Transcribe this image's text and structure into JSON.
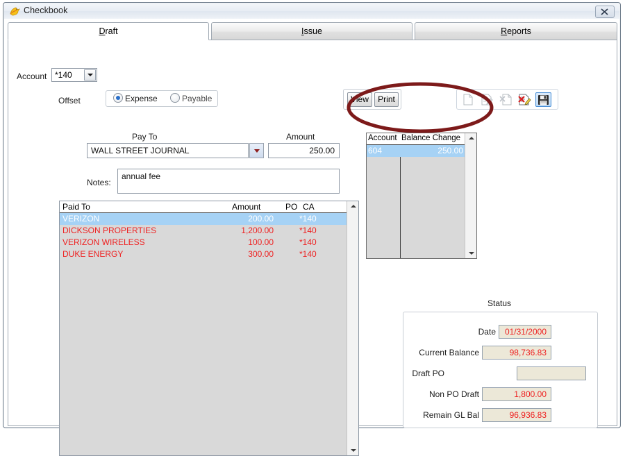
{
  "window": {
    "title": "Checkbook",
    "icon": "app-bird-icon",
    "close_label": "Close"
  },
  "tabs": [
    {
      "id": "draft",
      "label": "Draft",
      "mnemonic": "D",
      "active": true
    },
    {
      "id": "issue",
      "label": "Issue",
      "mnemonic": "I",
      "active": false
    },
    {
      "id": "reports",
      "label": "Reports",
      "mnemonic": "R",
      "active": false
    }
  ],
  "account": {
    "label": "Account",
    "value": "*140"
  },
  "offset": {
    "label": "Offset",
    "options": [
      {
        "label": "Expense",
        "checked": true
      },
      {
        "label": "Payable",
        "checked": false
      }
    ]
  },
  "entry": {
    "payto_label": "Pay To",
    "payto_value": "WALL STREET JOURNAL",
    "amount_label": "Amount",
    "amount_value": "250.00",
    "notes_label": "Notes:",
    "notes_value": "annual fee"
  },
  "actions": {
    "view_label": "View",
    "print_label": "Print"
  },
  "toolbar": {
    "buttons": [
      {
        "name": "new-document-icon",
        "enabled": false,
        "selected": false
      },
      {
        "name": "edit-document-icon",
        "enabled": false,
        "selected": false
      },
      {
        "name": "export-document-icon",
        "enabled": false,
        "selected": false
      },
      {
        "name": "delete-document-icon",
        "enabled": true,
        "selected": false
      },
      {
        "name": "save-icon",
        "enabled": true,
        "selected": true
      }
    ]
  },
  "paid_to_grid": {
    "columns": [
      "Paid To",
      "Amount",
      "PO",
      "CA"
    ],
    "rows": [
      {
        "name": "VERIZON",
        "amount": "200.00",
        "po": "",
        "ca": "*140",
        "selected": true
      },
      {
        "name": "DICKSON PROPERTIES",
        "amount": "1,200.00",
        "po": "",
        "ca": "*140",
        "selected": false
      },
      {
        "name": "VERIZON WIRELESS",
        "amount": "100.00",
        "po": "",
        "ca": "*140",
        "selected": false
      },
      {
        "name": "DUKE ENERGY",
        "amount": "300.00",
        "po": "",
        "ca": "*140",
        "selected": false
      }
    ]
  },
  "account_balance_grid": {
    "columns": [
      "Account",
      "Balance Change"
    ],
    "rows": [
      {
        "account": "604",
        "balance_change": "250.00",
        "selected": true
      }
    ]
  },
  "annotation": {
    "shape": "ellipse",
    "color": "#7d1a1a",
    "target": "account-balance-change-grid"
  },
  "status": {
    "title": "Status",
    "fields": [
      {
        "label": "Date",
        "value": "01/31/2000"
      },
      {
        "label": "Current Balance",
        "value": "98,736.83"
      },
      {
        "label": "Draft PO",
        "value": ""
      },
      {
        "label": "Non PO Draft",
        "value": "1,800.00"
      },
      {
        "label": "Remain GL Bal",
        "value": "96,936.83"
      }
    ]
  },
  "colors": {
    "selection_blue": "#a6d2f5",
    "value_red": "#ee2222",
    "field_beige": "#ece8d8",
    "annotation_maroon": "#7d1a1a",
    "grid_gray": "#d9d9d9"
  }
}
